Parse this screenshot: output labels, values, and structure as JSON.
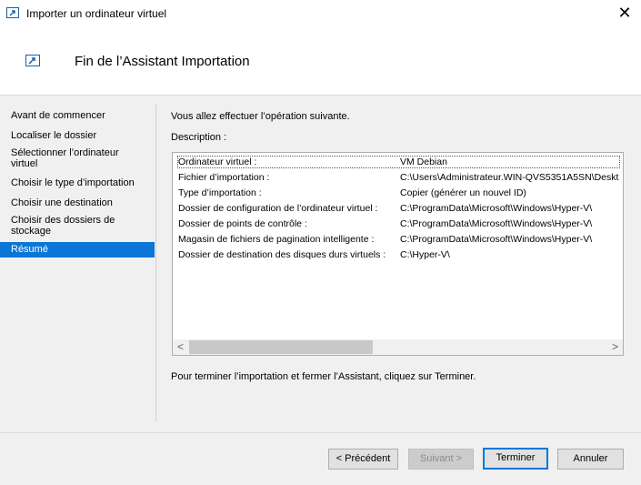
{
  "window": {
    "title": "Importer un ordinateur virtuel",
    "close_glyph": "✕",
    "icon": "import-arrow-icon"
  },
  "header": {
    "title": "Fin de l’Assistant Importation",
    "icon": "import-arrow-icon"
  },
  "nav": {
    "items": [
      {
        "label": "Avant de commencer"
      },
      {
        "label": "Localiser le dossier"
      },
      {
        "label": "Sélectionner l’ordinateur virtuel"
      },
      {
        "label": "Choisir le type d’importation"
      },
      {
        "label": "Choisir une destination"
      },
      {
        "label": "Choisir des dossiers de stockage"
      },
      {
        "label": "Résumé",
        "active": true
      }
    ]
  },
  "main": {
    "intro": "Vous allez effectuer l’opération suivante.",
    "description_label": "Description :",
    "rows": [
      {
        "key": "Ordinateur virtuel :",
        "value": "VM Debian"
      },
      {
        "key": "Fichier d’importation :",
        "value": "C:\\Users\\Administrateur.WIN-QVS5351A5SN\\Deskt"
      },
      {
        "key": "Type d’importation :",
        "value": "Copier (générer un nouvel ID)"
      },
      {
        "key": "Dossier de configuration de l’ordinateur virtuel :",
        "value": "C:\\ProgramData\\Microsoft\\Windows\\Hyper-V\\"
      },
      {
        "key": "Dossier de points de contrôle :",
        "value": "C:\\ProgramData\\Microsoft\\Windows\\Hyper-V\\"
      },
      {
        "key": "Magasin de fichiers de pagination intelligente :",
        "value": "C:\\ProgramData\\Microsoft\\Windows\\Hyper-V\\"
      },
      {
        "key": "Dossier de destination des disques durs virtuels :",
        "value": "C:\\Hyper-V\\"
      }
    ],
    "scroll_left_glyph": "<",
    "scroll_right_glyph": ">",
    "finish_text": "Pour terminer l’importation et fermer l’Assistant, cliquez sur Terminer."
  },
  "footer": {
    "previous_label": "< Précédent",
    "next_label": "Suivant >",
    "finish_label": "Terminer",
    "cancel_label": "Annuler"
  },
  "colors": {
    "selection": "#0b76d6",
    "default_button_border": "#0078d7"
  }
}
